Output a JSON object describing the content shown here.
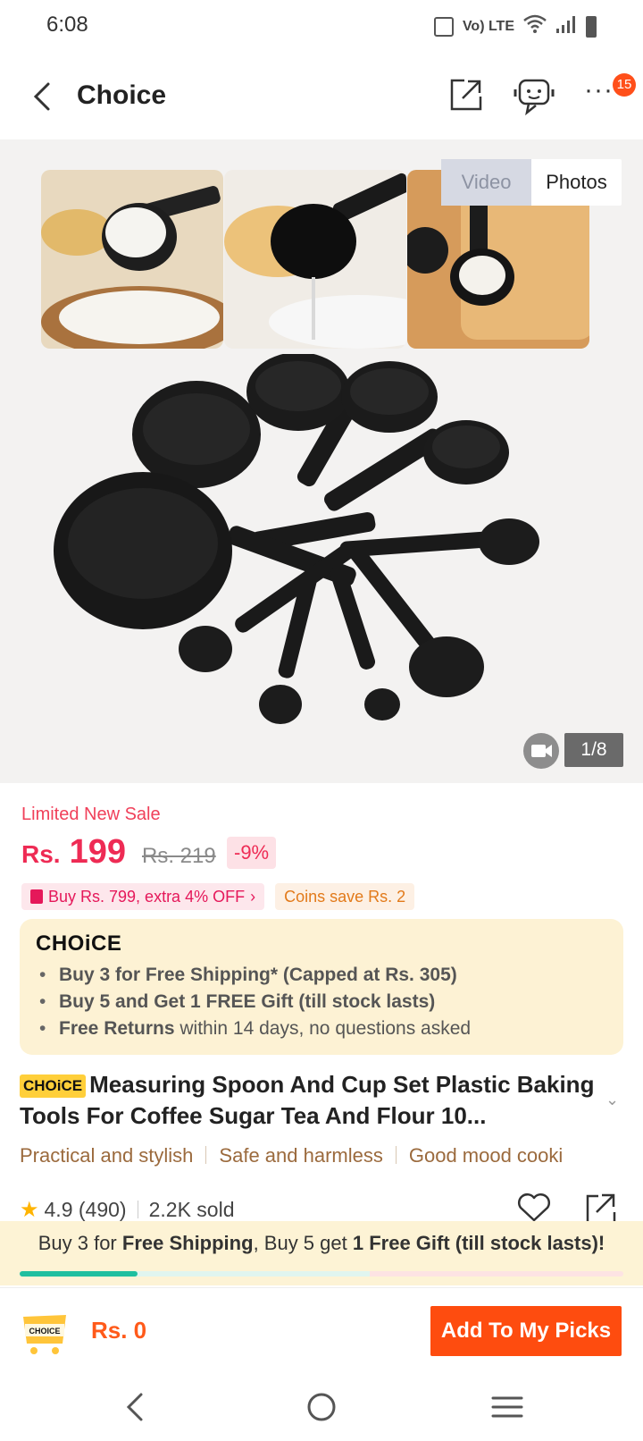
{
  "status": {
    "time": "6:08",
    "icons": [
      "vibrate-icon",
      "volte-icon",
      "wifi-icon",
      "signal-icon",
      "battery-icon"
    ],
    "volte_label": "Vo) LTE"
  },
  "header": {
    "title": "Choice",
    "notification_count": "15",
    "more_label": "···"
  },
  "gallery": {
    "tabs": [
      "Video",
      "Photos"
    ],
    "active_tab": "Photos",
    "counter": "1/8"
  },
  "pricing": {
    "sale_label": "Limited New Sale",
    "currency": "Rs.",
    "price": "199",
    "old_price": "Rs. 219",
    "discount": "-9%",
    "promo_coupon": "Buy Rs. 799, extra 4% OFF",
    "promo_coins": "Coins save Rs. 2"
  },
  "choice_box": {
    "logo": "CHOiCE",
    "items": [
      {
        "bold": "Buy 3 for  Free Shipping* (Capped at Rs. 305)",
        "rest": ""
      },
      {
        "bold": "Buy 5 and Get 1 FREE Gift (till stock lasts)",
        "rest": ""
      },
      {
        "bold": "Free Returns",
        "rest": " within 14 days, no questions asked"
      }
    ]
  },
  "product": {
    "tag": "CHOiCE",
    "title": "Measuring Spoon And Cup Set Plastic Baking Tools For Coffee Sugar Tea And Flour 10...",
    "tags": [
      "Practical and stylish",
      "Safe and harmless",
      "Good mood cooki"
    ],
    "rating": "4.9",
    "reviews": "(490)",
    "sold": "2.2K sold"
  },
  "shipping_banner": {
    "part1": "Buy 3 for ",
    "part2": "Free Shipping",
    "part3": ", Buy 5 get ",
    "part4": "1 Free Gift (till stock lasts)!",
    "progress_fraction": 0.195
  },
  "action_bar": {
    "cart_label": "CHOICE",
    "total": "Rs. 0",
    "button": "Add To My Picks"
  },
  "colors": {
    "accent": "#fe4c0f",
    "price": "#ee2b54",
    "choice_bg": "#fdf2d4",
    "progress": "#1fbf9f"
  }
}
